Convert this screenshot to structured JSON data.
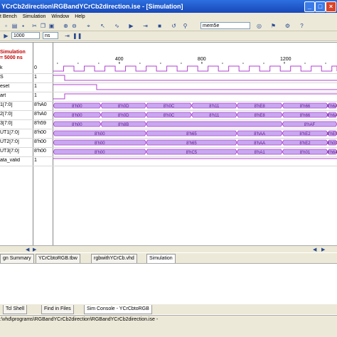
{
  "window": {
    "title": "YCrCb2direction\\RGBandYCrCb2direction.ise - [Simulation]"
  },
  "menu": [
    "t Bench",
    "Simulation",
    "Window",
    "Help"
  ],
  "toolbar": {
    "time_value": "1000",
    "time_unit": "ns",
    "signal_search": "mem5e"
  },
  "simulation": {
    "header_label": "Simulation",
    "header_time": "= 5000 ns"
  },
  "time_axis": {
    "ticks": [
      400,
      800,
      1200
    ],
    "range_start": 80,
    "range_end": 1455
  },
  "signals": [
    {
      "name": "k",
      "value": "0",
      "kind": "clock"
    },
    {
      "name": "S",
      "value": "1",
      "kind": "bit",
      "transitions": [
        [
          80,
          1
        ],
        [
          135,
          0
        ]
      ]
    },
    {
      "name": "eset",
      "value": "1",
      "kind": "bit",
      "transitions": [
        [
          80,
          1
        ],
        [
          290,
          0
        ]
      ]
    },
    {
      "name": "art",
      "value": "1",
      "kind": "bit",
      "transitions": [
        [
          80,
          0
        ],
        [
          135,
          1
        ]
      ]
    },
    {
      "name": "1[7:0]",
      "value": "8'hA0",
      "kind": "bus",
      "segments": [
        [
          80,
          310,
          "8'h00"
        ],
        [
          310,
          530,
          "8'h0D"
        ],
        [
          530,
          750,
          "8'h0C"
        ],
        [
          750,
          970,
          "8'h11"
        ],
        [
          970,
          1190,
          "8'hE8"
        ],
        [
          1190,
          1410,
          "8'h66"
        ],
        [
          1410,
          1455,
          "8'h6A"
        ]
      ]
    },
    {
      "name": "2[7:0]",
      "value": "8'hA0",
      "kind": "bus",
      "segments": [
        [
          80,
          310,
          "8'h00"
        ],
        [
          310,
          530,
          "8'h0D"
        ],
        [
          530,
          750,
          "8'h0C"
        ],
        [
          750,
          970,
          "8'h11"
        ],
        [
          970,
          1190,
          "8'hE8"
        ],
        [
          1190,
          1410,
          "8'h66"
        ],
        [
          1410,
          1455,
          "8'h6A"
        ]
      ]
    },
    {
      "name": "3[7:0]",
      "value": "8'h59",
      "kind": "bus",
      "segments": [
        [
          80,
          310,
          "8'h00"
        ],
        [
          310,
          530,
          "8'h8B"
        ],
        [
          530,
          1190,
          ""
        ],
        [
          1190,
          1455,
          "8'hAF"
        ]
      ]
    },
    {
      "name": "UT1[7:0]",
      "value": "8'h00",
      "kind": "bus",
      "segments": [
        [
          80,
          530,
          "8'h00"
        ],
        [
          530,
          970,
          "8'h65"
        ],
        [
          970,
          1190,
          "8'hAA"
        ],
        [
          1190,
          1410,
          "8'hE2"
        ],
        [
          1410,
          1455,
          "8'hE5"
        ]
      ]
    },
    {
      "name": "UT2[7:0]",
      "value": "8'h00",
      "kind": "bus",
      "segments": [
        [
          80,
          530,
          "8'h00"
        ],
        [
          530,
          970,
          "8'h65"
        ],
        [
          970,
          1190,
          "8'hAA"
        ],
        [
          1190,
          1410,
          "8'hE2"
        ],
        [
          1410,
          1455,
          "8'h00"
        ]
      ]
    },
    {
      "name": "UT3[7:0]",
      "value": "8'h00",
      "kind": "bus",
      "segments": [
        [
          80,
          530,
          "8'h00"
        ],
        [
          530,
          970,
          "8'hC5"
        ],
        [
          970,
          1190,
          "8'hA1"
        ],
        [
          1190,
          1410,
          "8'h01"
        ],
        [
          1410,
          1455,
          "8'h64"
        ]
      ]
    },
    {
      "name": "ata_valid",
      "value": "1",
      "kind": "bit",
      "transitions": [
        [
          80,
          1
        ],
        [
          530,
          1
        ]
      ]
    }
  ],
  "doc_tabs": [
    {
      "label": "gn Summary",
      "active": false
    },
    {
      "label": "YCrCbtoRGB.tbw",
      "active": false
    },
    {
      "label": "rgbwithYCrCb.vhd",
      "active": false
    },
    {
      "label": "Simulation",
      "active": true
    }
  ],
  "bottom_tabs": [
    {
      "label": "Tcl Shell",
      "active": false
    },
    {
      "label": "Find in Files",
      "active": false
    },
    {
      "label": "Sim Console - YCrCbtoRGB",
      "active": true
    }
  ],
  "status": {
    "path": ":\\vhd\\programs\\RGBandYCrCb2direction\\RGBandYCrCb2direction.ise -"
  },
  "colors": {
    "wave": "#b040d0",
    "bus_fill": "#c8a8f0",
    "title_bar": "#1d56c8"
  }
}
